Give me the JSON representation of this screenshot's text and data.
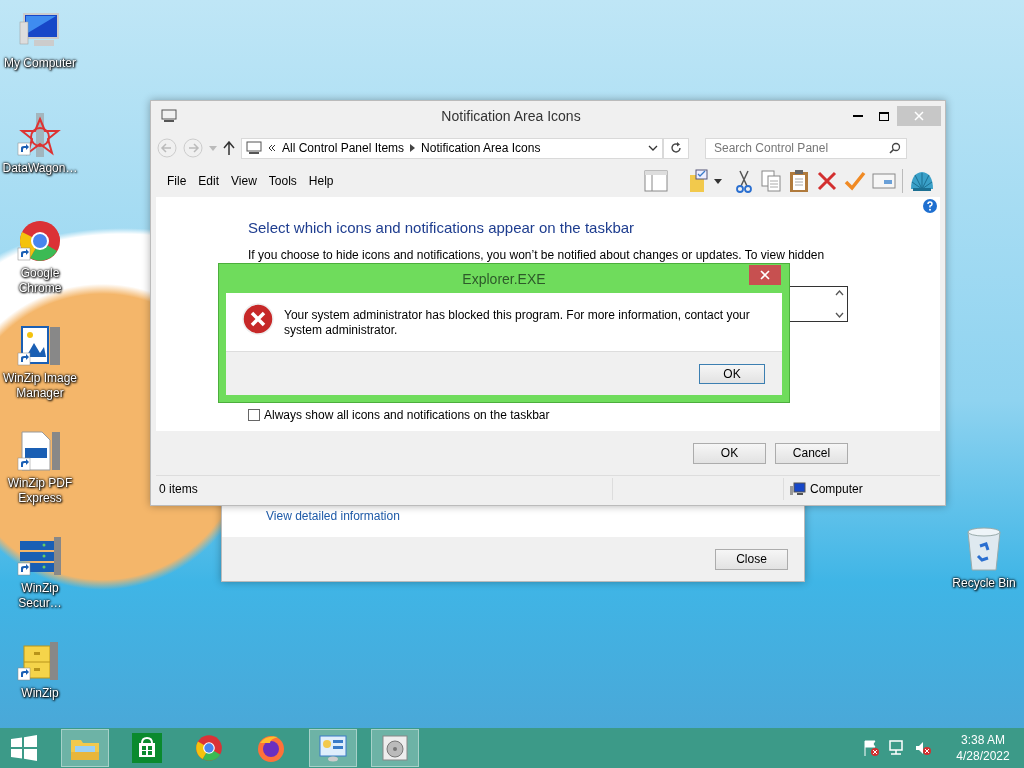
{
  "desktop": {
    "icons": [
      {
        "label": "My Computer",
        "kind": "computer",
        "shortcut": false
      },
      {
        "label": "DataWagon…",
        "kind": "star",
        "shortcut": true
      },
      {
        "label": "Google Chrome",
        "kind": "chrome",
        "shortcut": true
      },
      {
        "label": "WinZip Image Manager",
        "kind": "image",
        "shortcut": true
      },
      {
        "label": "WinZip PDF Express",
        "kind": "pdf",
        "shortcut": true
      },
      {
        "label": "WinZip Secur…",
        "kind": "server",
        "shortcut": true
      },
      {
        "label": "WinZip",
        "kind": "archive",
        "shortcut": true
      }
    ],
    "recycle_bin": {
      "label": "Recycle Bin"
    }
  },
  "back_window": {
    "link": "View detailed information",
    "buttons": [
      "Close"
    ]
  },
  "window": {
    "title": "Notification Area Icons",
    "breadcrumb": [
      "All Control Panel Items",
      "Notification Area Icons"
    ],
    "search": {
      "placeholder": "Search Control Panel"
    },
    "menu": [
      "File",
      "Edit",
      "View",
      "Tools",
      "Help"
    ],
    "heading": "Select which icons and notifications appear on the taskbar",
    "description": "If you choose to hide icons and notifications, you won’t be notified about changes or updates. To view hidden",
    "always_show": {
      "label": "Always show all icons and notifications on the taskbar",
      "checked": false
    },
    "buttons": [
      "OK",
      "Cancel"
    ],
    "status_bar": {
      "items": "0 items",
      "location": "Computer"
    }
  },
  "dialog": {
    "title": "Explorer.EXE",
    "message": "Your system administrator has blocked this program. For more information, contact your system administrator.",
    "buttons": [
      "OK"
    ]
  },
  "taskbar": {
    "apps": [
      {
        "kind": "explorer",
        "running": true
      },
      {
        "kind": "store",
        "running": false
      },
      {
        "kind": "chrome",
        "running": false
      },
      {
        "kind": "firefox",
        "running": false
      },
      {
        "kind": "control-panel",
        "running": true
      },
      {
        "kind": "disk",
        "running": true
      }
    ],
    "clock": {
      "time": "3:38 AM",
      "date": "4/28/2022"
    }
  }
}
